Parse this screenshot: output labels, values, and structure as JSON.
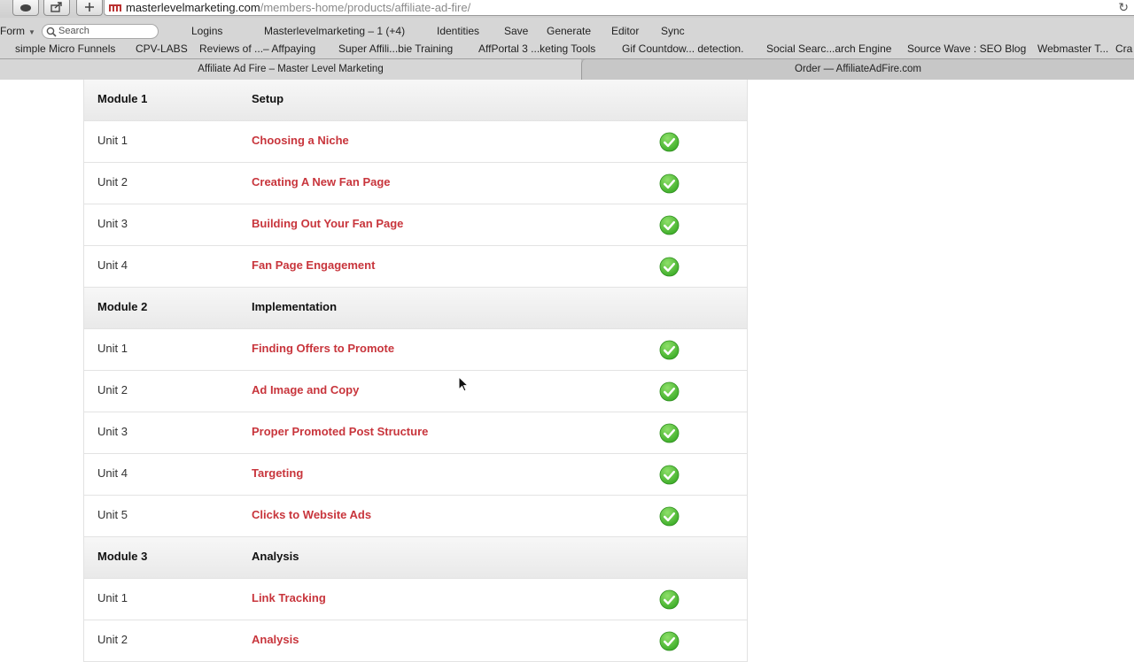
{
  "browser": {
    "address": {
      "domain": "masterlevelmarketing.com",
      "path": "/members-home/products/affiliate-ad-fire/"
    },
    "toolbar": {
      "form_menu": "Form",
      "search_placeholder": "Search",
      "items": [
        "Logins",
        "Masterlevelmarketing – 1 (+4)",
        "Identities",
        "Save",
        "Generate",
        "Editor",
        "Sync"
      ]
    },
    "bookmarks": [
      "simple Micro Funnels",
      "CPV-LABS",
      "Reviews of ...– Affpaying",
      "Super Affili...bie Training",
      "AffPortal 3 ...keting Tools",
      "Gif Countdow... detection.",
      "Social Searc...arch Engine",
      "Source Wave : SEO Blog",
      "Webmaster T...",
      "Cra"
    ],
    "tabs": [
      {
        "title": "Affiliate Ad Fire – Master Level Marketing",
        "active": true
      },
      {
        "title": "Order — AffiliateAdFire.com",
        "active": false
      }
    ]
  },
  "course": {
    "rows": [
      {
        "type": "module",
        "col1": "Module 1",
        "col2": "Setup"
      },
      {
        "type": "unit",
        "col1": "Unit 1",
        "col2": "Choosing a Niche",
        "complete": true
      },
      {
        "type": "unit",
        "col1": "Unit 2",
        "col2": "Creating A New Fan Page",
        "complete": true
      },
      {
        "type": "unit",
        "col1": "Unit 3",
        "col2": "Building Out Your Fan Page",
        "complete": true
      },
      {
        "type": "unit",
        "col1": "Unit 4",
        "col2": "Fan Page Engagement",
        "complete": true
      },
      {
        "type": "module",
        "col1": "Module 2",
        "col2": "Implementation"
      },
      {
        "type": "unit",
        "col1": "Unit 1",
        "col2": "Finding Offers to Promote",
        "complete": true
      },
      {
        "type": "unit",
        "col1": "Unit 2",
        "col2": "Ad Image and Copy",
        "complete": true
      },
      {
        "type": "unit",
        "col1": "Unit 3",
        "col2": "Proper Promoted Post Structure",
        "complete": true
      },
      {
        "type": "unit",
        "col1": "Unit 4",
        "col2": "Targeting",
        "complete": true
      },
      {
        "type": "unit",
        "col1": "Unit 5",
        "col2": "Clicks to Website Ads",
        "complete": true
      },
      {
        "type": "module",
        "col1": "Module 3",
        "col2": "Analysis"
      },
      {
        "type": "unit",
        "col1": "Unit 1",
        "col2": "Link Tracking",
        "complete": true
      },
      {
        "type": "unit",
        "col1": "Unit 2",
        "col2": "Analysis",
        "complete": true
      }
    ]
  },
  "colors": {
    "link": "#c8353c",
    "check_green": "#3fae2a"
  },
  "icons": {
    "complete": "check-circle-icon",
    "search": "search-icon",
    "reload": "reload-icon",
    "cursor": "mouse-cursor-icon"
  }
}
